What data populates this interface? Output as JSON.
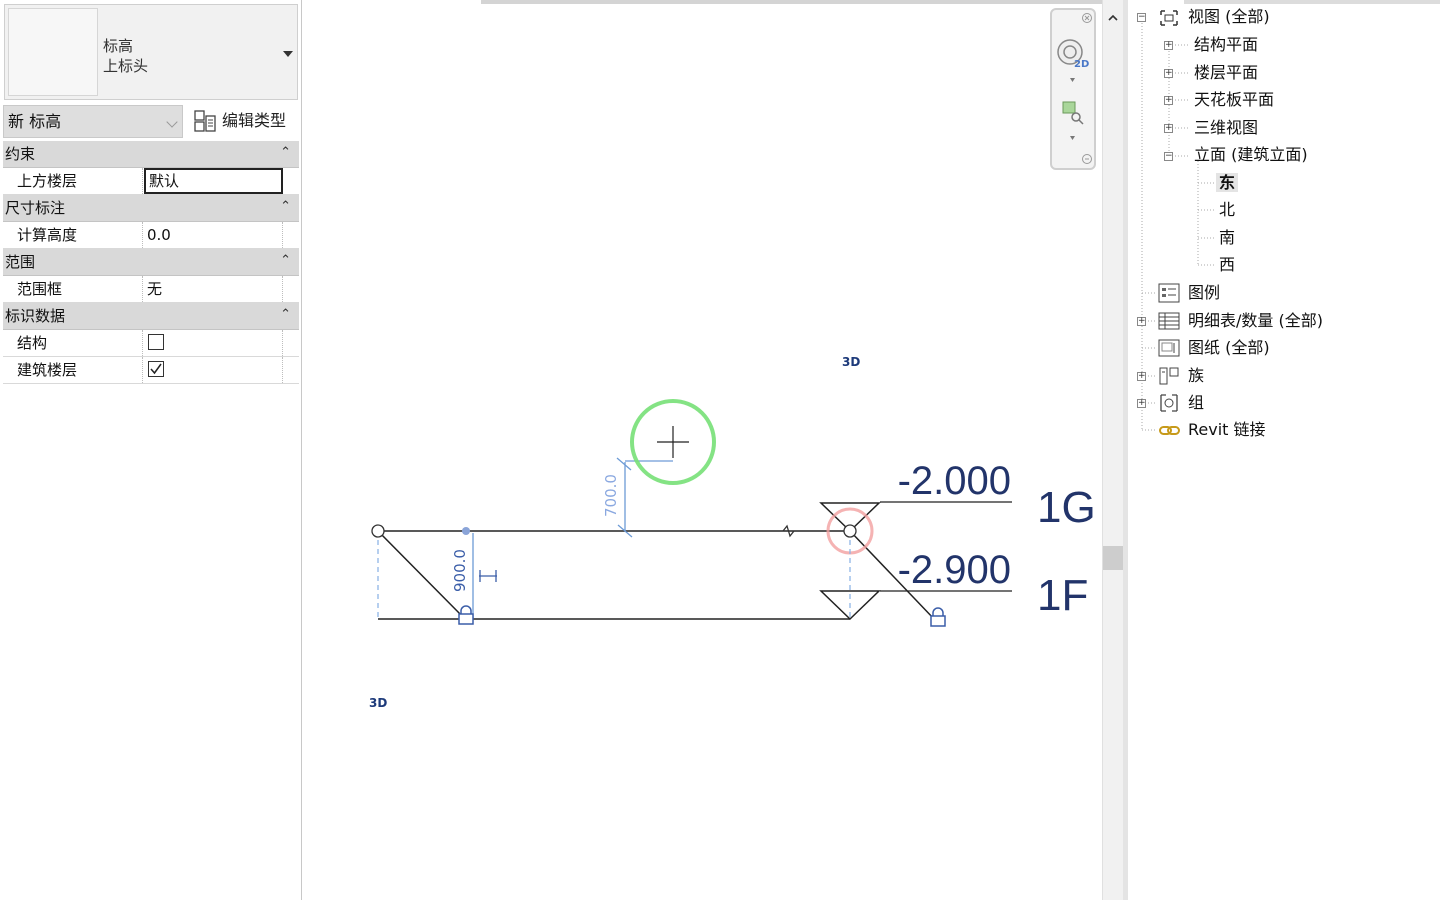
{
  "properties": {
    "type_family": "标高",
    "type_name": "上标头",
    "instance_selector": "新 标高",
    "edit_type_label": "编辑类型",
    "collapse_glyph": "⌃",
    "groups": [
      {
        "name": "约束",
        "rows": [
          {
            "label": "上方楼层",
            "value": "默认",
            "editing": true
          }
        ]
      },
      {
        "name": "尺寸标注",
        "rows": [
          {
            "label": "计算高度",
            "value": "0.0"
          }
        ]
      },
      {
        "name": "范围",
        "rows": [
          {
            "label": "范围框",
            "value": "无"
          }
        ]
      },
      {
        "name": "标识数据",
        "rows": [
          {
            "label": "结构",
            "checked": false
          },
          {
            "label": "建筑楼层",
            "checked": true
          }
        ]
      }
    ]
  },
  "canvas": {
    "label_3d_top": "3D",
    "label_3d_bottom": "3D",
    "levels": [
      {
        "elevation": "-2.000",
        "name": "1G"
      },
      {
        "elevation": "-2.900",
        "name": "1F"
      }
    ],
    "dim_temp": "700.0",
    "dim_height": "900.0",
    "nav_2d_label": "2D",
    "colors": {
      "level_text": "#22346a",
      "dim_blue": "#6d9bd6",
      "cursor_green": "#66dd66",
      "highlight_red": "#f0a0a0"
    }
  },
  "project_browser": {
    "items": [
      {
        "label": "视图 (全部)",
        "expander": "−"
      },
      {
        "label": "结构平面",
        "expander": "+"
      },
      {
        "label": "楼层平面",
        "expander": "+"
      },
      {
        "label": "天花板平面",
        "expander": "+"
      },
      {
        "label": "三维视图",
        "expander": "+"
      },
      {
        "label": "立面 (建筑立面)",
        "expander": "−"
      },
      {
        "label": "东",
        "selected": true
      },
      {
        "label": "北"
      },
      {
        "label": "南"
      },
      {
        "label": "西"
      },
      {
        "label": "图例"
      },
      {
        "label": "明细表/数量 (全部)",
        "expander": "+"
      },
      {
        "label": "图纸 (全部)"
      },
      {
        "label": "族",
        "expander": "+"
      },
      {
        "label": "组",
        "expander": "+"
      },
      {
        "label": "Revit 链接"
      }
    ]
  }
}
